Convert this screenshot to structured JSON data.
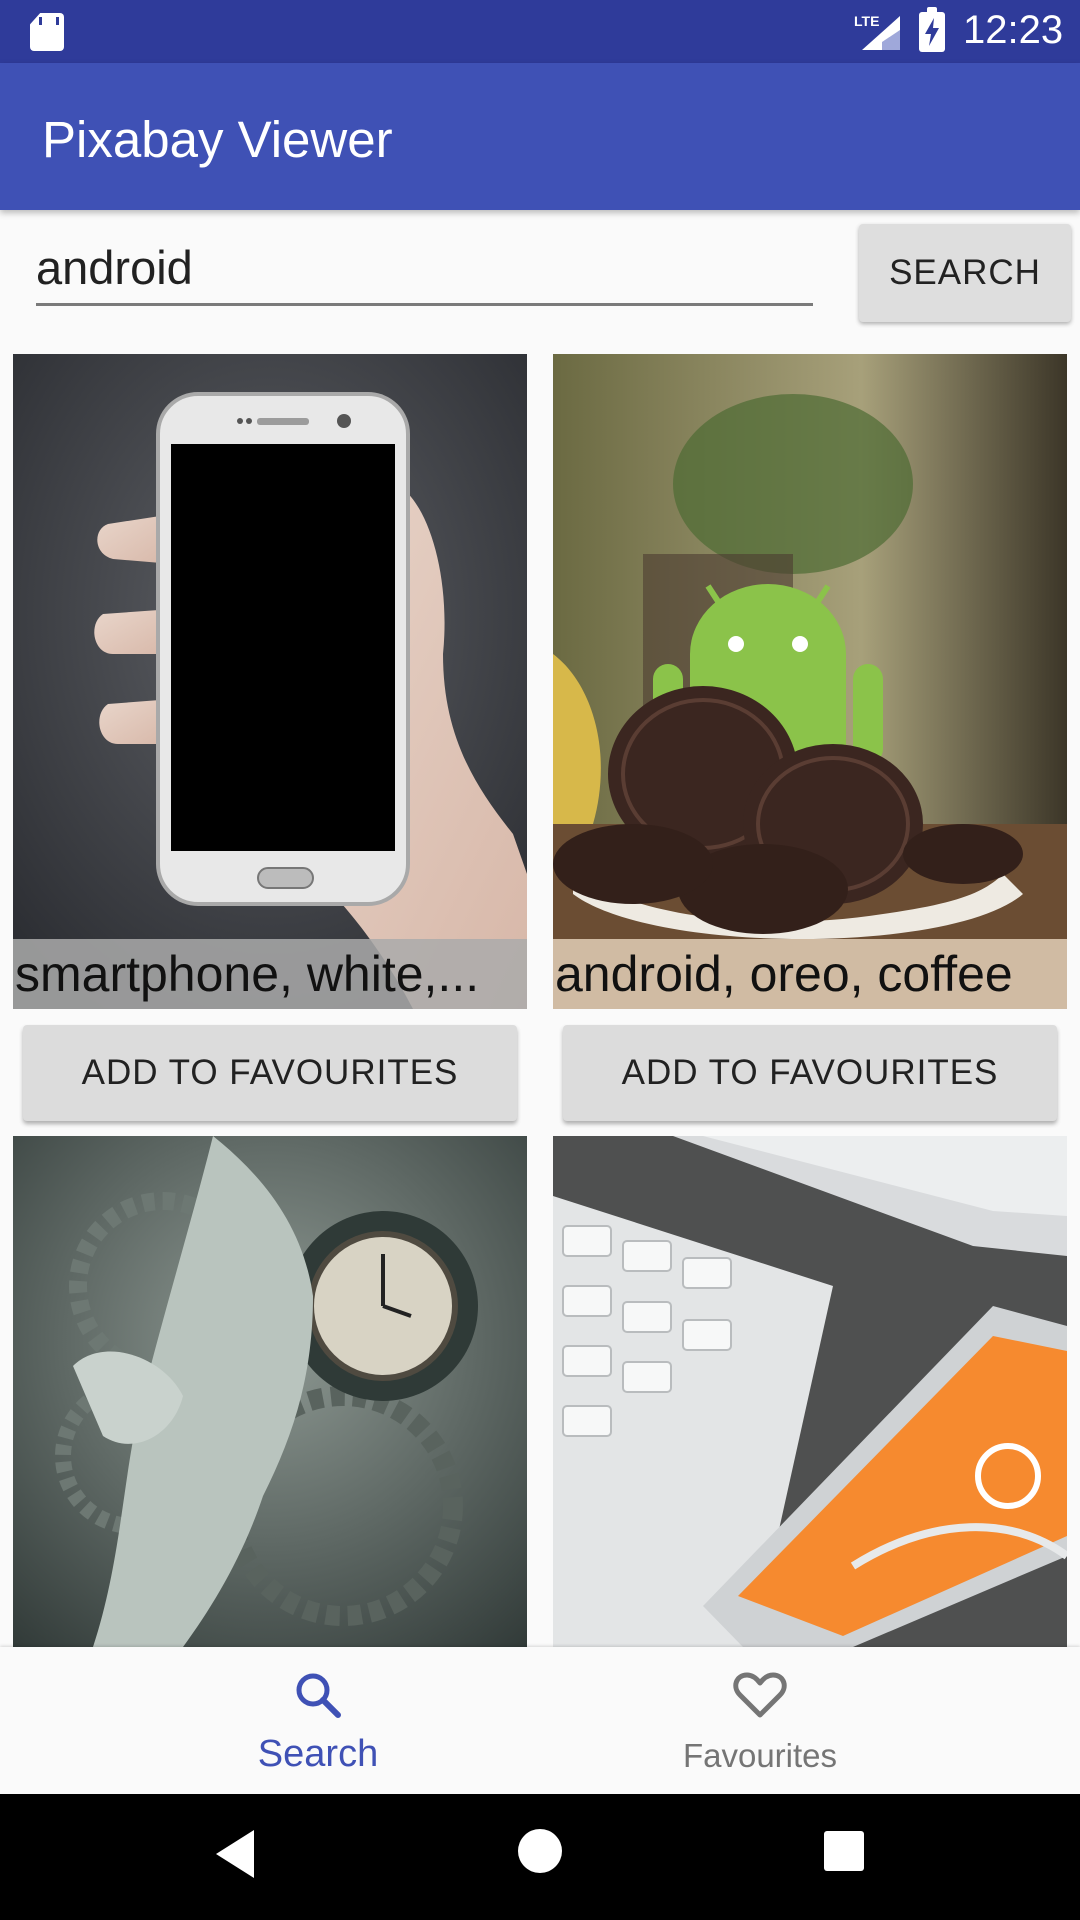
{
  "status_bar": {
    "time": "12:23",
    "icons": [
      "sd-card-icon",
      "lte-signal-icon",
      "battery-charging-icon"
    ],
    "color": "#2f3b9a"
  },
  "app_bar": {
    "title": "Pixabay Viewer",
    "color": "#3f51b5"
  },
  "search": {
    "query": "android",
    "button_label": "SEARCH"
  },
  "results": [
    {
      "caption": "smartphone, white,...",
      "button_label": "ADD TO FAVOURITES",
      "image": "smartphone-in-hand"
    },
    {
      "caption": "android, oreo, coffee",
      "button_label": "ADD TO FAVOURITES",
      "image": "android-oreo-cookies"
    },
    {
      "caption": "",
      "button_label": "",
      "image": "woman-clock-gears"
    },
    {
      "caption": "",
      "button_label": "",
      "image": "keyboard-and-phone"
    }
  ],
  "bottom_nav": {
    "items": [
      {
        "label": "Search",
        "icon": "search-icon",
        "active": true
      },
      {
        "label": "Favourites",
        "icon": "heart-icon",
        "active": false
      }
    ],
    "active_color": "#3f51b5"
  },
  "system_nav": {
    "icons": [
      "back-icon",
      "home-icon",
      "recents-icon"
    ]
  }
}
